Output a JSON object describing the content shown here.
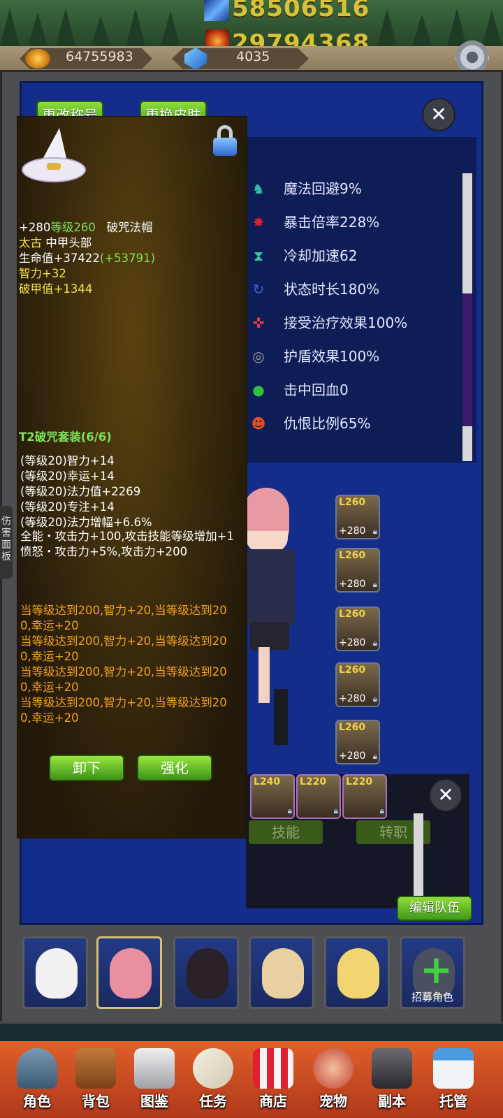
{
  "header": {
    "power_top": "58506516",
    "power_second": "29794368",
    "gold": "64755983",
    "gems": "4035"
  },
  "profile_buttons": {
    "rename": "更改称号",
    "skin": "更换皮肤"
  },
  "stats": [
    {
      "label": "魔法回避9%",
      "icon": "ghost-icon",
      "color": "#37c0b0"
    },
    {
      "label": "暴击倍率228%",
      "icon": "flame-icon",
      "color": "#e02030"
    },
    {
      "label": "冷却加速62",
      "icon": "hourglass-icon",
      "color": "#40c0a0"
    },
    {
      "label": "状态时长180%",
      "icon": "swirl-icon",
      "color": "#4060d0"
    },
    {
      "label": "接受治疗效果100%",
      "icon": "cross-arrows-icon",
      "color": "#e04040"
    },
    {
      "label": "护盾效果100%",
      "icon": "shield-ring-icon",
      "color": "#a0a0a0"
    },
    {
      "label": "击中回血0",
      "icon": "blood-drop-icon",
      "color": "#30c040"
    },
    {
      "label": "仇恨比例65%",
      "icon": "demon-face-icon",
      "color": "#e05020"
    }
  ],
  "equip_slots_right": [
    {
      "level": "L260",
      "plus": "+280"
    },
    {
      "level": "L260",
      "plus": "+280"
    },
    {
      "level": "L260",
      "plus": "+280"
    },
    {
      "level": "L260",
      "plus": "+280"
    },
    {
      "level": "L260",
      "plus": "+280"
    }
  ],
  "equip_slots_bottom": [
    {
      "level": "L240"
    },
    {
      "level": "L220"
    },
    {
      "level": "L220"
    }
  ],
  "lower_buttons": {
    "skill": "技能",
    "job": "转职",
    "edit_team": "编辑队伍"
  },
  "side_tab": "伤害面板",
  "tooltip": {
    "header_plus": "+280",
    "header_level": "等级260",
    "item_name": "破咒法帽",
    "rarity": "太古",
    "slot_type": "中甲头部",
    "hp": "生命值+37422",
    "hp_bonus": "(+53791)",
    "int": "智力+32",
    "armor_break": "破甲值+1344",
    "set_title": "T2破咒套装(6/6)",
    "set_bonuses": [
      "(等级20)智力+14",
      "(等级20)幸运+14",
      "(等级20)法力值+2269",
      "(等级20)专注+14",
      "(等级20)法力增幅+6.6%",
      "全能・攻击力+100,攻击技能等级增加+1",
      "愤怒・攻击力+5%,攻击力+200"
    ],
    "level_effects": [
      "当等级达到200,智力+20,当等级达到20",
      "0,幸运+20",
      "当等级达到200,智力+20,当等级达到20",
      "0,幸运+20",
      "当等级达到200,智力+20,当等级达到20",
      "0,幸运+20",
      "当等级达到200,智力+20,当等级达到20",
      "0,幸运+20"
    ],
    "unequip": "卸下",
    "enhance": "强化"
  },
  "roster": [
    {
      "name": "",
      "selected": false
    },
    {
      "name": "",
      "selected": true
    },
    {
      "name": "",
      "selected": false
    },
    {
      "name": "",
      "selected": false
    },
    {
      "name": "",
      "selected": false
    },
    {
      "name": "招募角色",
      "selected": false
    }
  ],
  "nav": [
    "角色",
    "背包",
    "图鉴",
    "任务",
    "商店",
    "宠物",
    "副本",
    "托管"
  ]
}
